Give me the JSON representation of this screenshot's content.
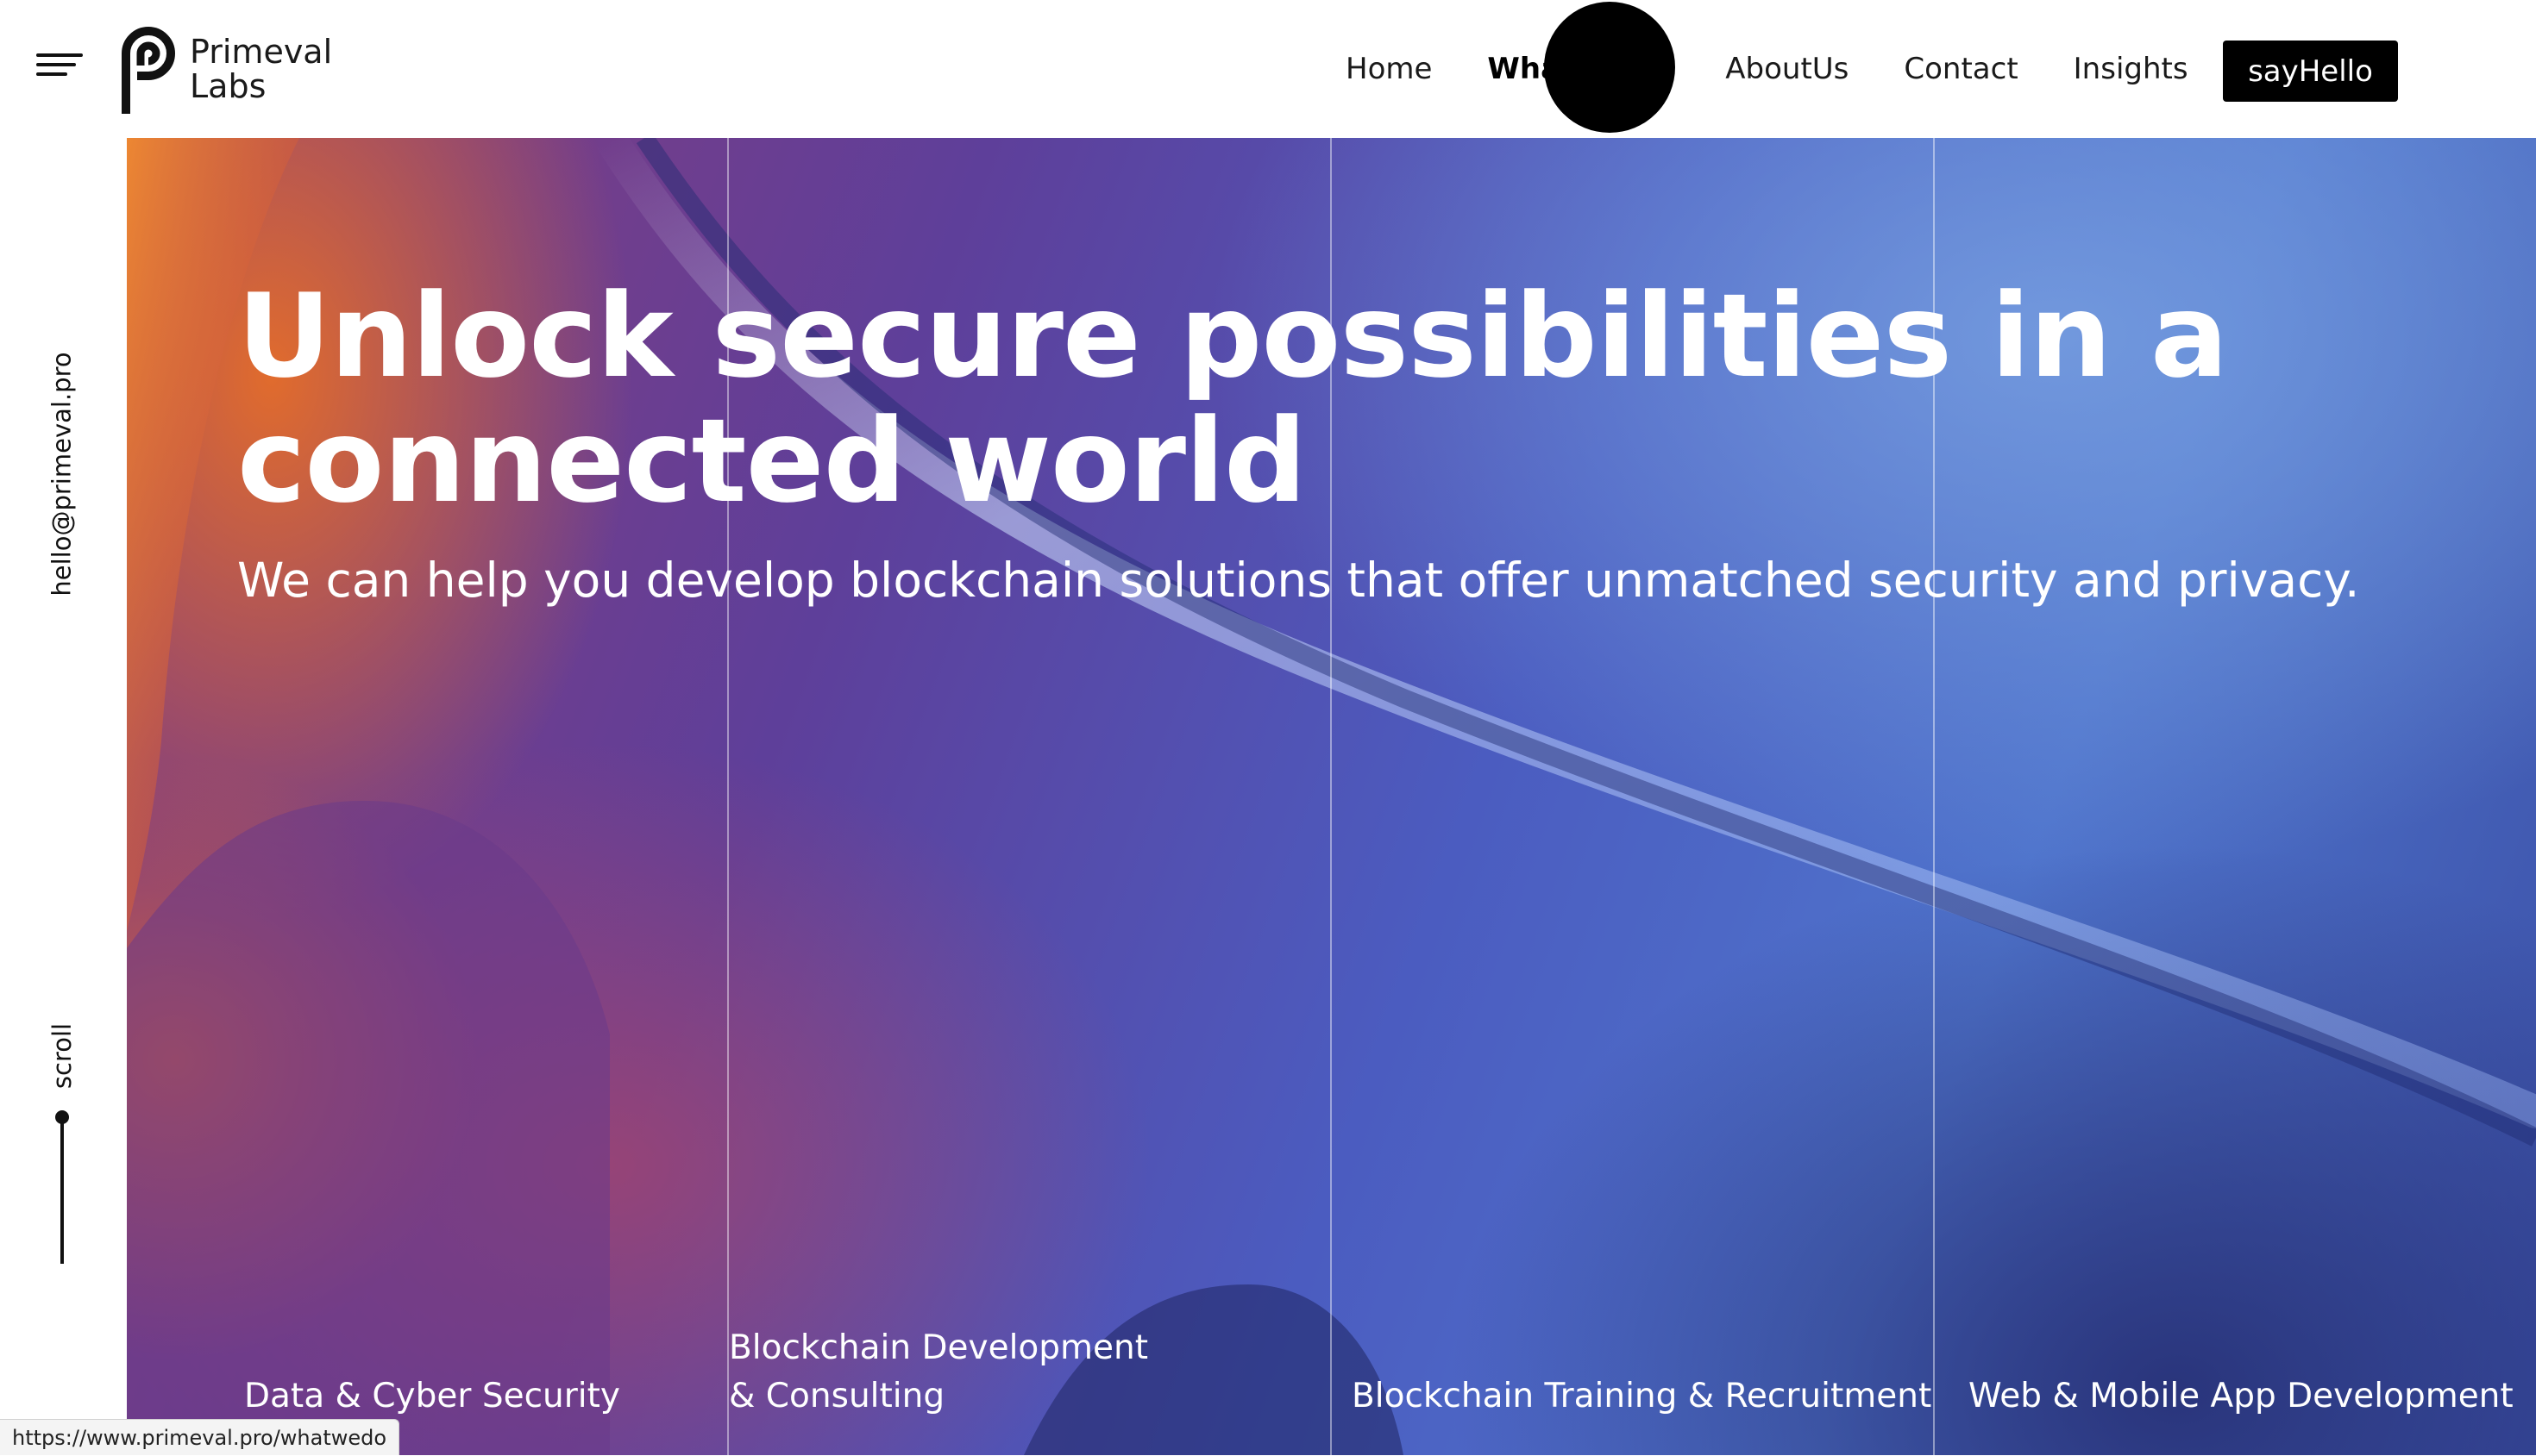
{
  "header": {
    "logo_name": "Primeval\nLabs",
    "nav": [
      {
        "label": "Home"
      },
      {
        "label": "WhatWeDo"
      },
      {
        "label": "AboutUs"
      },
      {
        "label": "Contact"
      },
      {
        "label": "Insights"
      }
    ],
    "cta_label": "sayHello",
    "menu_icon": "hamburger-icon",
    "logo_icon": "primeval-p-logo-icon"
  },
  "sidebar": {
    "email": "hello@primeval.pro",
    "scroll_label": "scroll"
  },
  "hero": {
    "title": "Unlock secure possibilities in a connected world",
    "subtitle": "We can help you develop blockchain solutions that offer unmatched security and privacy.",
    "services": [
      {
        "label": "Data & Cyber Security"
      },
      {
        "label": "Blockchain Development & Consulting"
      },
      {
        "label": "Blockchain Training & Recruitment"
      },
      {
        "label": "Web & Mobile App Development"
      }
    ]
  },
  "status_bar": {
    "url": "https://www.primeval.pro/whatwedo"
  },
  "colors": {
    "nav_active_bg": "#000000",
    "cta_bg": "#000000",
    "cta_text": "#ffffff",
    "hero_text": "#ffffff"
  }
}
